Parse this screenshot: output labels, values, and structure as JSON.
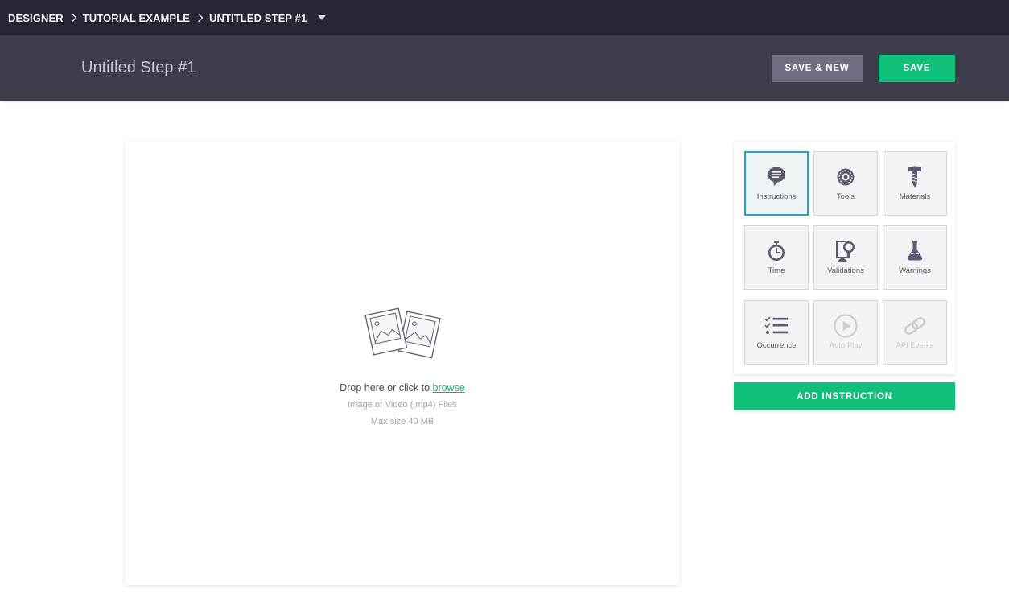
{
  "breadcrumb": {
    "items": [
      "DESIGNER",
      "TUTORIAL EXAMPLE",
      "UNTITLED STEP #1"
    ]
  },
  "header": {
    "title": "Untitled Step #1",
    "save_new_label": "SAVE & NEW",
    "save_label": "SAVE"
  },
  "dropzone": {
    "prompt": "Drop here or click to",
    "link": "browse",
    "file_types": "Image or Video (.mp4) Files",
    "max_size": "Max size 40 MB"
  },
  "tools": [
    {
      "label": "Instructions",
      "icon": "speech-bubble-icon",
      "state": "selected"
    },
    {
      "label": "Tools",
      "icon": "saw-blade-icon",
      "state": "enabled"
    },
    {
      "label": "Materials",
      "icon": "screw-icon",
      "state": "enabled"
    },
    {
      "label": "Time",
      "icon": "stopwatch-icon",
      "state": "enabled"
    },
    {
      "label": "Validations",
      "icon": "validation-icon",
      "state": "enabled"
    },
    {
      "label": "Warnings",
      "icon": "flask-icon",
      "state": "enabled"
    },
    {
      "label": "Occurrence",
      "icon": "checklist-icon",
      "state": "enabled"
    },
    {
      "label": "Auto Play",
      "icon": "play-circle-icon",
      "state": "disabled"
    },
    {
      "label": "API Events",
      "icon": "link-chain-icon",
      "state": "disabled"
    }
  ],
  "add_button_label": "ADD INSTRUCTION",
  "colors": {
    "topbar": "#262634",
    "header": "#3d3d4b",
    "primary_green": "#10c07a",
    "secondary_button": "#6f6f82",
    "selected_border": "#1fa5c2",
    "icon": "#5c5c6e"
  }
}
